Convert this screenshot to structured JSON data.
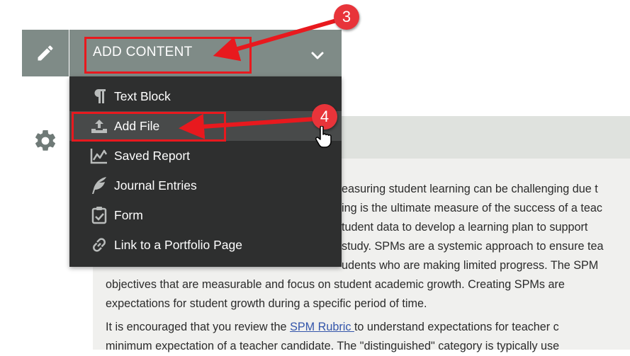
{
  "header": {
    "add_content_label": "ADD CONTENT"
  },
  "icons": {
    "edit": "pencil-icon",
    "settings": "gear-icon",
    "expand": "chevron-down-icon"
  },
  "menu": {
    "items": [
      {
        "label": "Text Block",
        "icon": "pilcrow-icon"
      },
      {
        "label": "Add File",
        "icon": "upload-icon"
      },
      {
        "label": "Saved Report",
        "icon": "chart-icon"
      },
      {
        "label": "Journal Entries",
        "icon": "feather-icon"
      },
      {
        "label": "Form",
        "icon": "clipboard-check-icon"
      },
      {
        "label": "Link to a Portfolio Page",
        "icon": "link-icon"
      }
    ],
    "hovered_index": 1
  },
  "content": {
    "lines": [
      "easuring student learning can be challenging due t",
      "ing is the ultimate measure of the success of a teac",
      "tudent data to develop a learning plan to support",
      "study. SPMs are a systemic approach to ensure tea",
      "udents who are making limited progress. The SPM",
      "objectives that are measurable and focus on student academic growth. Creating SPMs are",
      "expectations for student growth during a specific period of time."
    ],
    "para2_before": "It is encouraged that you review the ",
    "para2_link": "SPM Rubric ",
    "para2_after": "to understand expectations for teacher c",
    "para2_line2": "minimum expectation of a teacher candidate. The \"distinguished\" category is typically use"
  },
  "annotations": {
    "step3": "3",
    "step4": "4",
    "color": "#e8191e"
  },
  "colors": {
    "bar": "#7f8b87",
    "menu_bg": "#2e2f2f",
    "menu_hover": "#484a4a"
  }
}
